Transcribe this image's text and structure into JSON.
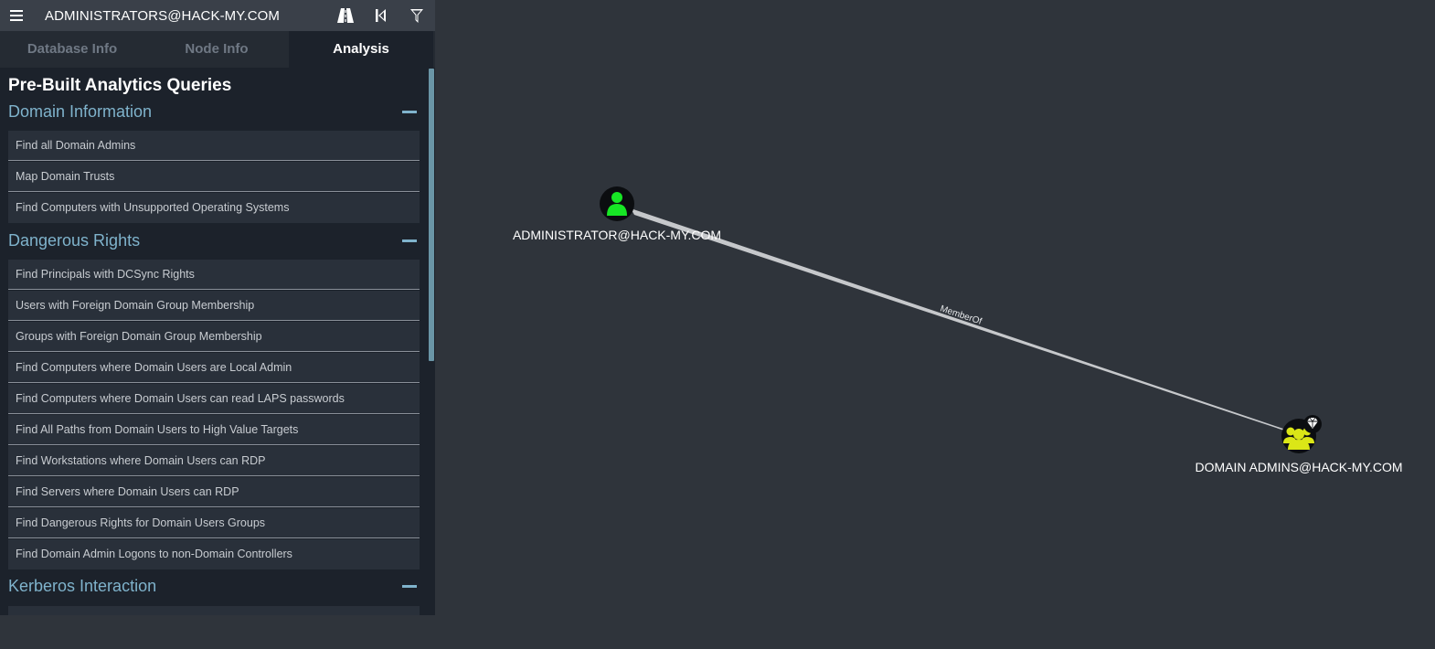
{
  "search": {
    "value": "ADMINISTRATORS@HACK-MY.COM"
  },
  "toolbar": {
    "icons": [
      "menu-icon",
      "road-icon",
      "back-icon",
      "filter-icon"
    ]
  },
  "tabs": [
    {
      "label": "Database Info",
      "active": false
    },
    {
      "label": "Node Info",
      "active": false
    },
    {
      "label": "Analysis",
      "active": true
    }
  ],
  "analysis": {
    "title": "Pre-Built Analytics Queries",
    "sections": [
      {
        "title": "Domain Information",
        "queries": [
          "Find all Domain Admins",
          "Map Domain Trusts",
          "Find Computers with Unsupported Operating Systems"
        ]
      },
      {
        "title": "Dangerous Rights",
        "queries": [
          "Find Principals with DCSync Rights",
          "Users with Foreign Domain Group Membership",
          "Groups with Foreign Domain Group Membership",
          "Find Computers where Domain Users are Local Admin",
          "Find Computers where Domain Users can read LAPS passwords",
          "Find All Paths from Domain Users to High Value Targets",
          "Find Workstations where Domain Users can RDP",
          "Find Servers where Domain Users can RDP",
          "Find Dangerous Rights for Domain Users Groups",
          "Find Domain Admin Logons to non-Domain Controllers"
        ]
      },
      {
        "title": "Kerberos Interaction",
        "queries": []
      }
    ]
  },
  "graph": {
    "nodes": [
      {
        "label": "ADMINISTRATOR@HACK-MY.COM",
        "type": "user",
        "color": "#17e625"
      },
      {
        "label": "DOMAIN ADMINS@HACK-MY.COM",
        "type": "group",
        "color": "#dbe617",
        "high_value": true
      }
    ],
    "edges": [
      {
        "label": "MemberOf"
      }
    ]
  },
  "colors": {
    "background": "#2f343b",
    "panel": "#1c222b",
    "section_title": "#7fb3cc",
    "user_node": "#17e625",
    "group_node": "#dbe617"
  }
}
